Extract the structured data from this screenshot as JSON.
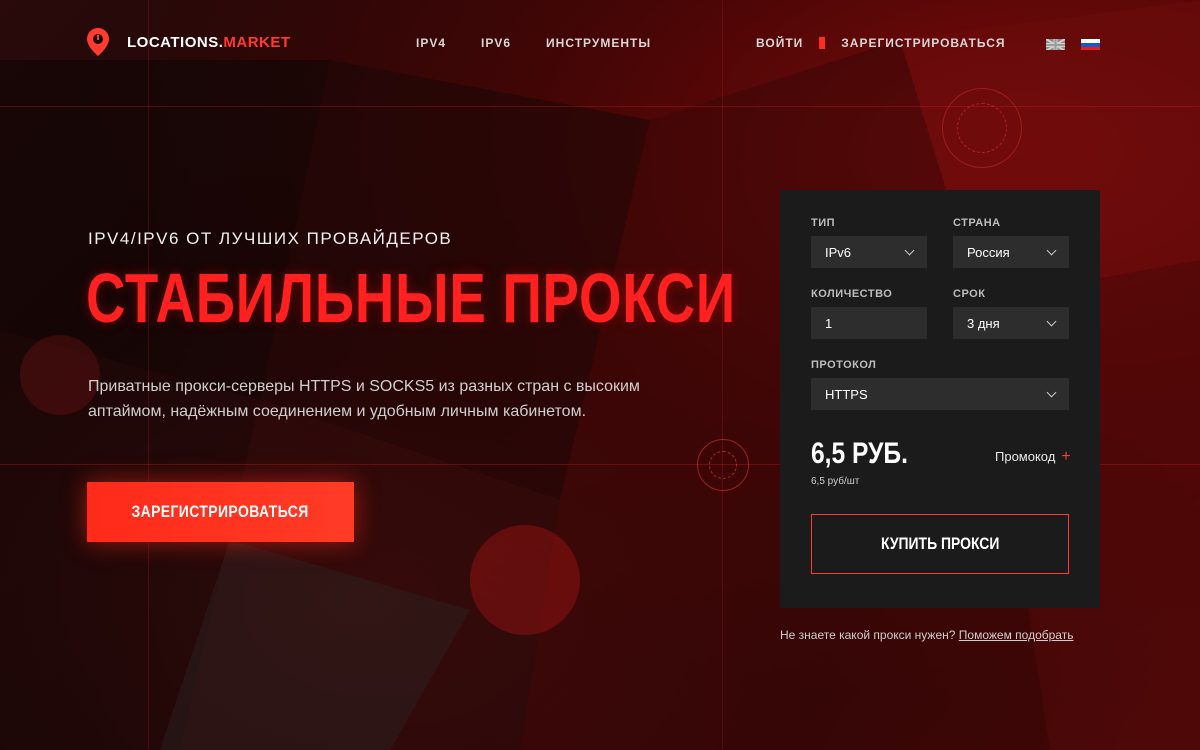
{
  "header": {
    "logo_main": "LOCATIONS.",
    "logo_accent": "MARKET",
    "nav": [
      "IPV4",
      "IPV6",
      "ИНСТРУМЕНТЫ"
    ],
    "login": "ВОЙТИ",
    "register": "ЗАРЕГИСТРИРОВАТЬСЯ",
    "languages": [
      "en",
      "ru"
    ]
  },
  "hero": {
    "subtitle": "IPV4/IPV6 ОТ ЛУЧШИХ ПРОВАЙДЕРОВ",
    "title": "СТАБИЛЬНЫЕ ПРОКСИ",
    "description": "Приватные прокси-серверы HTTPS и SOCKS5 из разных стран с высоким аптаймом, надёжным соединением и удобным личным кабинетом.",
    "cta": "ЗАРЕГИСТРИРОВАТЬСЯ"
  },
  "order": {
    "type_label": "ТИП",
    "type_value": "IPv6",
    "country_label": "СТРАНА",
    "country_value": "Россия",
    "quantity_label": "КОЛИЧЕСТВО",
    "quantity_value": "1",
    "term_label": "СРОК",
    "term_value": "3 дня",
    "protocol_label": "ПРОТОКОЛ",
    "protocol_value": "HTTPS",
    "price": "6,5 РУБ.",
    "unit_price": "6,5 руб/шт",
    "promo": "Промокод",
    "buy": "КУПИТЬ ПРОКСИ",
    "help_text": "Не знаете какой прокси нужен?",
    "help_link": "Поможем подобрать"
  },
  "colors": {
    "accent": "#ff2d20",
    "panel": "#1b1b1b",
    "field": "#2d2d2d"
  }
}
